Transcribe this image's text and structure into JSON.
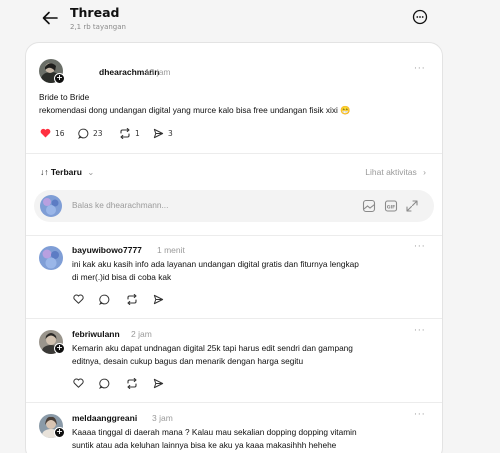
{
  "header": {
    "title": "Thread",
    "views": "2,1 rb tayangan"
  },
  "post": {
    "username": "dhearachmann",
    "time": "13 jam",
    "text_line1": "Bride to Bride",
    "text_line2": "rekomendasi dong undangan digital yang murce kalo bisa free undangan fisik xixi 😁",
    "likes": "16",
    "comments": "23",
    "reposts": "1",
    "shares": "3",
    "liked": true
  },
  "sort": {
    "label": "Terbaru",
    "activity_label": "Lihat aktivitas"
  },
  "reply_box": {
    "placeholder": "Balas ke dhearachmann..."
  },
  "comments": [
    {
      "username": "bayuwibowo7777",
      "time": "1 menit",
      "line1": "ini kak aku kasih info ada layanan undangan digital gratis dan fiturnya lengkap",
      "line2": "di mer(.)id bisa di coba kak"
    },
    {
      "username": "febriwulann",
      "time": "2 jam",
      "line1": "Kemarin aku dapat undnagan digital 25k tapi harus edit sendri dan gampang",
      "line2": "editnya, desain cukup bagus dan menarik dengan harga segitu"
    },
    {
      "username": "meldaanggreani",
      "time": "3 jam",
      "line1": "Kaaaa tinggal di daerah mana ? Kalau mau sekalian dopping dopping vitamin",
      "line2": "suntik atau ada keluhan lainnya bisa ke aku ya kaaa makasihhh hehehe"
    }
  ],
  "colors": {
    "like_red": "#ff3040",
    "text": "#101010",
    "muted": "#9a9a9a"
  }
}
